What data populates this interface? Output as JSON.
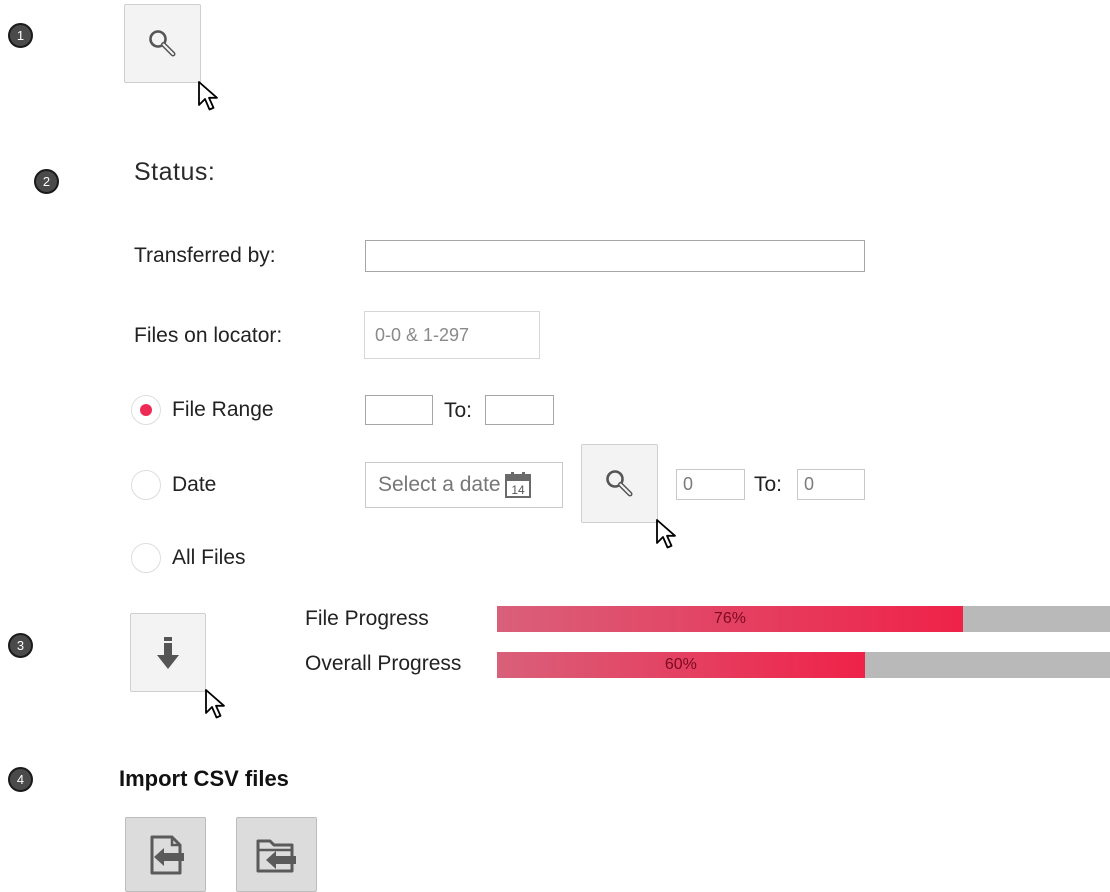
{
  "steps": [
    "1",
    "2",
    "3",
    "4"
  ],
  "search_button_icon": "magnifier-icon",
  "status": {
    "title": "Status:",
    "transferred_by_label": "Transferred by:",
    "transferred_by_value": "",
    "files_on_locator_label": "Files on locator:",
    "files_on_locator_value": "0-0 & 1-297"
  },
  "range_options": [
    {
      "label": "File Range",
      "selected": true
    },
    {
      "label": "Date",
      "selected": false
    },
    {
      "label": "All Files",
      "selected": false
    }
  ],
  "file_range": {
    "from_value": "",
    "to_label": "To:",
    "to_value": ""
  },
  "date_filter": {
    "placeholder": "Select a date",
    "calendar_day": "14",
    "from_value": "0",
    "to_label": "To:",
    "to_value": "0"
  },
  "progress": {
    "download_icon": "download-arrow-icon",
    "file_label": "File Progress",
    "file_percent": 76,
    "file_text": "76%",
    "overall_label": "Overall Progress",
    "overall_percent": 60,
    "overall_text": "60%"
  },
  "import": {
    "title": "Import CSV files",
    "import_file_icon": "import-file-icon",
    "import_folder_icon": "import-folder-icon"
  },
  "colors": {
    "accent": "#ee2b55",
    "progress_track": "#b9b9b9",
    "badge": "#4a4a4a"
  }
}
